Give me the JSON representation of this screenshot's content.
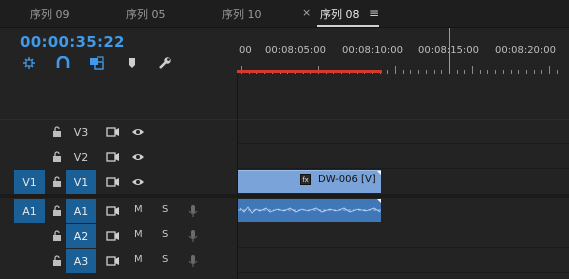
{
  "tabs": [
    {
      "label": "序列 09",
      "active": false
    },
    {
      "label": "序列 05",
      "active": false
    },
    {
      "label": "序列 10",
      "active": false
    },
    {
      "label": "序列 08",
      "active": true
    }
  ],
  "tab_close_glyph": "×",
  "tab_menu_glyph": "≡",
  "timecode": "00:00:35:22",
  "tools": [
    {
      "name": "insert-overwrite-icon"
    },
    {
      "name": "snap-icon"
    },
    {
      "name": "linked-selection-icon"
    },
    {
      "name": "add-marker-icon"
    },
    {
      "name": "wrench-icon"
    }
  ],
  "ruler": {
    "labels": [
      "00",
      "00:08:05:00",
      "00:08:10:00",
      "00:08:15:00",
      "00:08:20:00"
    ]
  },
  "tracks": {
    "V3": {
      "target": "V3",
      "source": ""
    },
    "V2": {
      "target": "V2",
      "source": ""
    },
    "V1": {
      "target": "V1",
      "source": "V1"
    },
    "A1": {
      "target": "A1",
      "source": "A1",
      "m": "M",
      "s": "S"
    },
    "A2": {
      "target": "A2",
      "m": "M",
      "s": "S"
    },
    "A3": {
      "target": "A3",
      "m": "M",
      "s": "S"
    }
  },
  "clip_video": {
    "fx": "fx",
    "name": "DW-006 [V]"
  },
  "colors": {
    "timecode": "#3f9bea",
    "target_on": "#1a5f96",
    "video_clip": "#7aa3d9",
    "audio_clip": "#3f77b9",
    "work_area": "#d33a2c"
  }
}
